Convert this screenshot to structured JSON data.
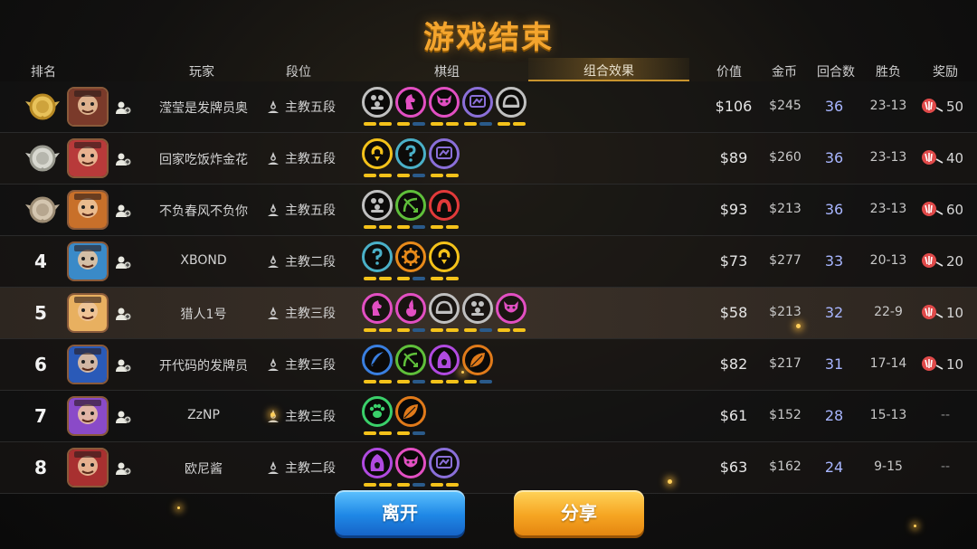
{
  "title": "游戏结束",
  "headers": {
    "rank": "排名",
    "player": "玩家",
    "tier": "段位",
    "pieces": "棋组",
    "combo": "组合效果",
    "value": "价值",
    "gold": "金币",
    "rounds": "回合数",
    "record": "胜负",
    "reward": "奖励"
  },
  "colors": {
    "title": "#f4a52e",
    "rounds": "#a8b6ff",
    "leave_button": "#1f88e6",
    "share_button": "#f6a623",
    "bar_active": "#f4c21a",
    "bar_inactive": "#2a5a8a"
  },
  "rows": [
    {
      "rank": "",
      "medal": "gold-medal-icon",
      "player": "滢莹是发牌员奥",
      "tier": "主教五段",
      "value": "$106",
      "gold": "$245",
      "rounds": "36",
      "record": "23-13",
      "reward": "50",
      "synergies": [
        {
          "icon": "troops-icon",
          "color": "#c0c0c0"
        },
        {
          "icon": "knight-icon",
          "color": "#e24fc2"
        },
        {
          "icon": "demon-icon",
          "color": "#e24fc2"
        },
        {
          "icon": "mech-icon",
          "color": "#8a6fd8"
        },
        {
          "icon": "helmet-icon",
          "color": "#c0c0c0"
        }
      ]
    },
    {
      "rank": "",
      "medal": "silver-medal-icon",
      "player": "回家吃饭炸金花",
      "tier": "主教五段",
      "value": "$89",
      "gold": "$260",
      "rounds": "36",
      "record": "23-13",
      "reward": "40",
      "synergies": [
        {
          "icon": "spirit-icon",
          "color": "#f4c21a"
        },
        {
          "icon": "question-icon",
          "color": "#4ab0c8"
        },
        {
          "icon": "mech-icon",
          "color": "#8a6fd8"
        }
      ]
    },
    {
      "rank": "",
      "medal": "bronze-medal-icon",
      "player": "不负春风不负你",
      "tier": "主教五段",
      "value": "$93",
      "gold": "$213",
      "rounds": "36",
      "record": "23-13",
      "reward": "60",
      "synergies": [
        {
          "icon": "troops-icon",
          "color": "#c0c0c0"
        },
        {
          "icon": "bow-icon",
          "color": "#5fbf3a"
        },
        {
          "icon": "arch-icon",
          "color": "#e23a3a"
        }
      ]
    },
    {
      "rank": "4",
      "medal": "",
      "player": "XBOND",
      "tier": "主教二段",
      "value": "$73",
      "gold": "$277",
      "rounds": "33",
      "record": "20-13",
      "reward": "20",
      "synergies": [
        {
          "icon": "question-icon",
          "color": "#4ab0c8"
        },
        {
          "icon": "gear-icon",
          "color": "#e88a1a"
        },
        {
          "icon": "spirit-icon",
          "color": "#f4c21a"
        }
      ]
    },
    {
      "rank": "5",
      "medal": "",
      "player": "猎人1号",
      "tier": "主教三段",
      "value": "$58",
      "gold": "$213",
      "rounds": "32",
      "record": "22-9",
      "reward": "10",
      "synergies": [
        {
          "icon": "knight-icon",
          "color": "#e24fc2"
        },
        {
          "icon": "flame-icon",
          "color": "#e24fc2"
        },
        {
          "icon": "helmet-icon",
          "color": "#c0c0c0"
        },
        {
          "icon": "troops-icon",
          "color": "#c0c0c0"
        },
        {
          "icon": "demon-icon",
          "color": "#e24fc2"
        }
      ]
    },
    {
      "rank": "6",
      "medal": "",
      "player": "开代码的发牌员",
      "tier": "主教三段",
      "value": "$82",
      "gold": "$217",
      "rounds": "31",
      "record": "17-14",
      "reward": "10",
      "synergies": [
        {
          "icon": "feather-icon",
          "color": "#3a7fe0"
        },
        {
          "icon": "bow-icon",
          "color": "#5fbf3a"
        },
        {
          "icon": "hood-icon",
          "color": "#b04ae0"
        },
        {
          "icon": "leaf-icon",
          "color": "#e07a1a"
        }
      ]
    },
    {
      "rank": "7",
      "medal": "",
      "player": "ZzNP",
      "tier": "主教三段",
      "value": "$61",
      "gold": "$152",
      "rounds": "28",
      "record": "15-13",
      "reward": "--",
      "synergies": [
        {
          "icon": "paw-icon",
          "color": "#3ad06a"
        },
        {
          "icon": "leaf-icon",
          "color": "#e07a1a"
        }
      ]
    },
    {
      "rank": "8",
      "medal": "",
      "player": "欧尼酱",
      "tier": "主教二段",
      "value": "$63",
      "gold": "$162",
      "rounds": "24",
      "record": "9-15",
      "reward": "--",
      "synergies": [
        {
          "icon": "hood-icon",
          "color": "#b04ae0"
        },
        {
          "icon": "demon-icon",
          "color": "#e24fc2"
        },
        {
          "icon": "mech-icon",
          "color": "#8a6fd8"
        }
      ]
    }
  ],
  "buttons": {
    "leave": "离开",
    "share": "分享"
  }
}
